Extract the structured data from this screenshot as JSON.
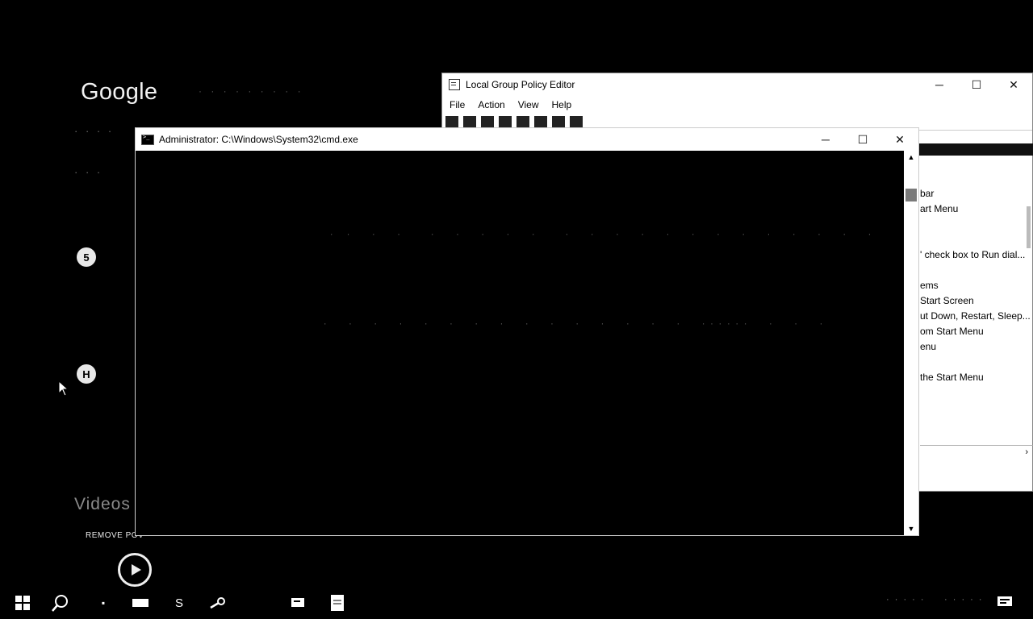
{
  "browser": {
    "logo_text": "Google",
    "videos_heading": "Videos",
    "video_caption": "REMOVE POV",
    "circle_icons": [
      "5",
      "H"
    ]
  },
  "gpe_window": {
    "title": "Local Group Policy Editor",
    "menu": [
      "File",
      "Action",
      "View",
      "Help"
    ],
    "list_items": [
      "bar",
      "art Menu",
      "",
      "",
      "' check box to Run dial...",
      "",
      "ems",
      "Start Screen",
      "ut Down, Restart, Sleep...",
      "om Start Menu",
      "enu",
      "",
      "the Start Menu"
    ]
  },
  "cmd_window": {
    "title": "Administrator: C:\\Windows\\System32\\cmd.exe",
    "line1": "· ·  ·  ·   ·  ·  ·  ·  ·   ·  ·  ·  ·  ·  ·  ·  ·  ·  ·  ·  ·  ·",
    "line2": "·  ·  ·  ·  ·  ·  ·  ·  ·  ·  ·  ·  ·  ·  ·  ······  ·  ·  ·"
  },
  "colors": {
    "background": "#000000",
    "window_chrome": "#ffffff",
    "scroll_thumb": "#7a7a7a"
  }
}
